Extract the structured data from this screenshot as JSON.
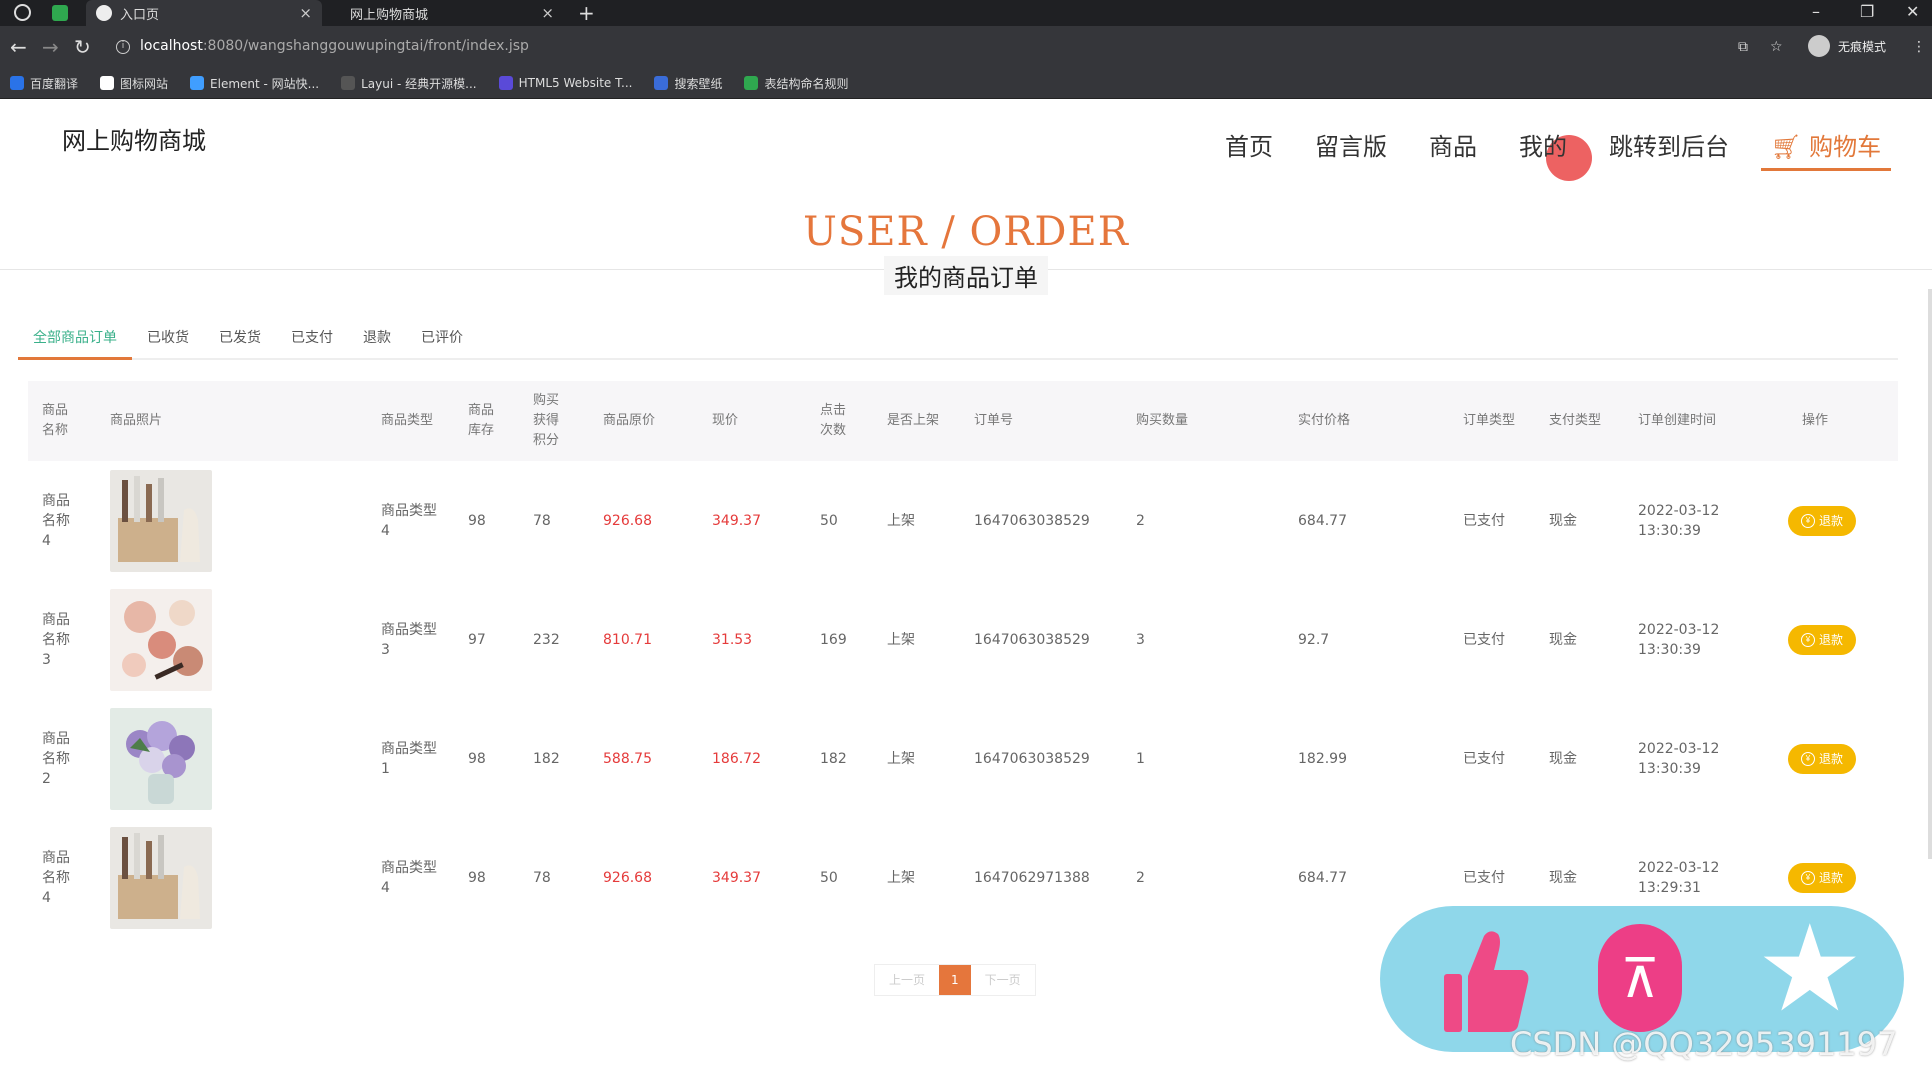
{
  "browser": {
    "tabs": [
      {
        "title": "入口页",
        "active": true
      },
      {
        "title": "网上购物商城",
        "active": false
      }
    ],
    "url_host": "localhost",
    "url_path": ":8080/wangshanggouwupingtai/front/index.jsp",
    "profile_label": "无痕模式",
    "bookmarks": [
      "百度翻译",
      "图标网站",
      "Element - 网站快...",
      "Layui - 经典开源模...",
      "HTML5 Website T...",
      "搜索壁纸",
      "表结构命名规则"
    ]
  },
  "site": {
    "title": "网上购物商城",
    "nav": [
      "首页",
      "留言版",
      "商品",
      "我的",
      "跳转到后台"
    ],
    "cart_label": "购物车"
  },
  "hero": {
    "en": "USER / ORDER",
    "cn": "我的商品订单"
  },
  "tabs": [
    "全部商品订单",
    "已收货",
    "已发货",
    "已支付",
    "退款",
    "已评价"
  ],
  "table": {
    "headers": {
      "name": "商品名称",
      "photo": "商品照片",
      "type": "商品类型",
      "stock": "商品库存",
      "points": "购买获得积分",
      "orig": "商品原价",
      "now": "现价",
      "clicks": "点击次数",
      "shelf": "是否上架",
      "order_no": "订单号",
      "qty": "购买数量",
      "paid": "实付价格",
      "order_type": "订单类型",
      "pay_type": "支付类型",
      "created": "订单创建时间",
      "action": "操作"
    },
    "rows": [
      {
        "name": "商品名称4",
        "img": "kitchen",
        "type": "商品类型4",
        "stock": "98",
        "points": "78",
        "orig": "926.68",
        "now": "349.37",
        "clicks": "50",
        "shelf": "上架",
        "order_no": "1647063038529",
        "qty": "2",
        "paid": "684.77",
        "order_type": "已支付",
        "pay_type": "现金",
        "created": "2022-03-12 13:30:39",
        "action": "退款"
      },
      {
        "name": "商品名称3",
        "img": "makeup",
        "type": "商品类型3",
        "stock": "97",
        "points": "232",
        "orig": "810.71",
        "now": "31.53",
        "clicks": "169",
        "shelf": "上架",
        "order_no": "1647063038529",
        "qty": "3",
        "paid": "92.7",
        "order_type": "已支付",
        "pay_type": "现金",
        "created": "2022-03-12 13:30:39",
        "action": "退款"
      },
      {
        "name": "商品名称2",
        "img": "flowers",
        "type": "商品类型1",
        "stock": "98",
        "points": "182",
        "orig": "588.75",
        "now": "186.72",
        "clicks": "182",
        "shelf": "上架",
        "order_no": "1647063038529",
        "qty": "1",
        "paid": "182.99",
        "order_type": "已支付",
        "pay_type": "现金",
        "created": "2022-03-12 13:30:39",
        "action": "退款"
      },
      {
        "name": "商品名称4",
        "img": "kitchen",
        "type": "商品类型4",
        "stock": "98",
        "points": "78",
        "orig": "926.68",
        "now": "349.37",
        "clicks": "50",
        "shelf": "上架",
        "order_no": "1647062971388",
        "qty": "2",
        "paid": "684.77",
        "order_type": "已支付",
        "pay_type": "现金",
        "created": "2022-03-12 13:29:31",
        "action": "退款"
      }
    ]
  },
  "pager": {
    "prev": "上一页",
    "current": "1",
    "next": "下一页"
  },
  "watermark": "CSDN @QQ3295391197",
  "colors": {
    "accent": "#e5763c",
    "price": "#e53b3b",
    "active_tab": "#3ab08a",
    "refund": "#f5b800"
  }
}
